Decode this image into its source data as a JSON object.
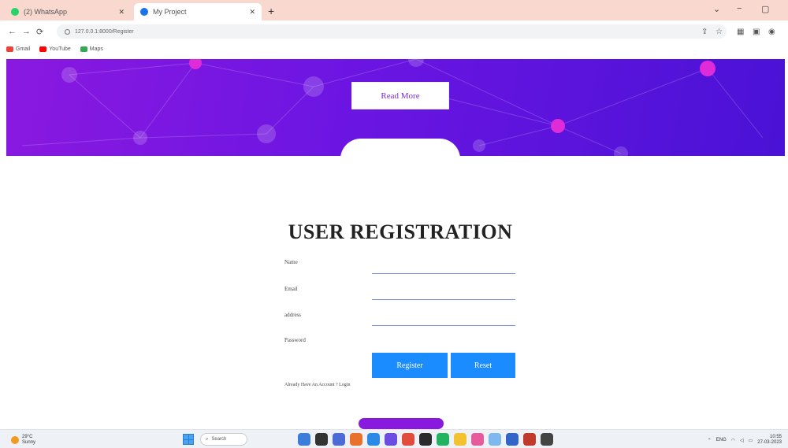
{
  "browser": {
    "tabs": [
      {
        "label": "(2) WhatsApp",
        "color": "#25d366"
      },
      {
        "label": "My Project",
        "color": "#1a73e8"
      }
    ],
    "url": "127.0.0.1:8000/Register",
    "bookmarks": [
      {
        "label": "Gmail",
        "color": "#ea4335"
      },
      {
        "label": "YouTube",
        "color": "#ff0000"
      },
      {
        "label": "Maps",
        "color": "#34a853"
      }
    ]
  },
  "hero": {
    "read_more_label": "Read More",
    "accent_color": "#8a19e0"
  },
  "form": {
    "title": "USER REGISTRATION",
    "fields": [
      {
        "label": "Name"
      },
      {
        "label": "Email"
      },
      {
        "label": "address"
      },
      {
        "label": "Password"
      }
    ],
    "register_label": "Register",
    "reset_label": "Reset",
    "login_text": "Already Have An Account ? Login",
    "button_color": "#1a8cff"
  },
  "taskbar": {
    "weather_temp": "29°C",
    "weather_desc": "Sunny",
    "search_label": "Search",
    "language": "ENG",
    "time": "10:55",
    "date": "27-03-2023"
  }
}
